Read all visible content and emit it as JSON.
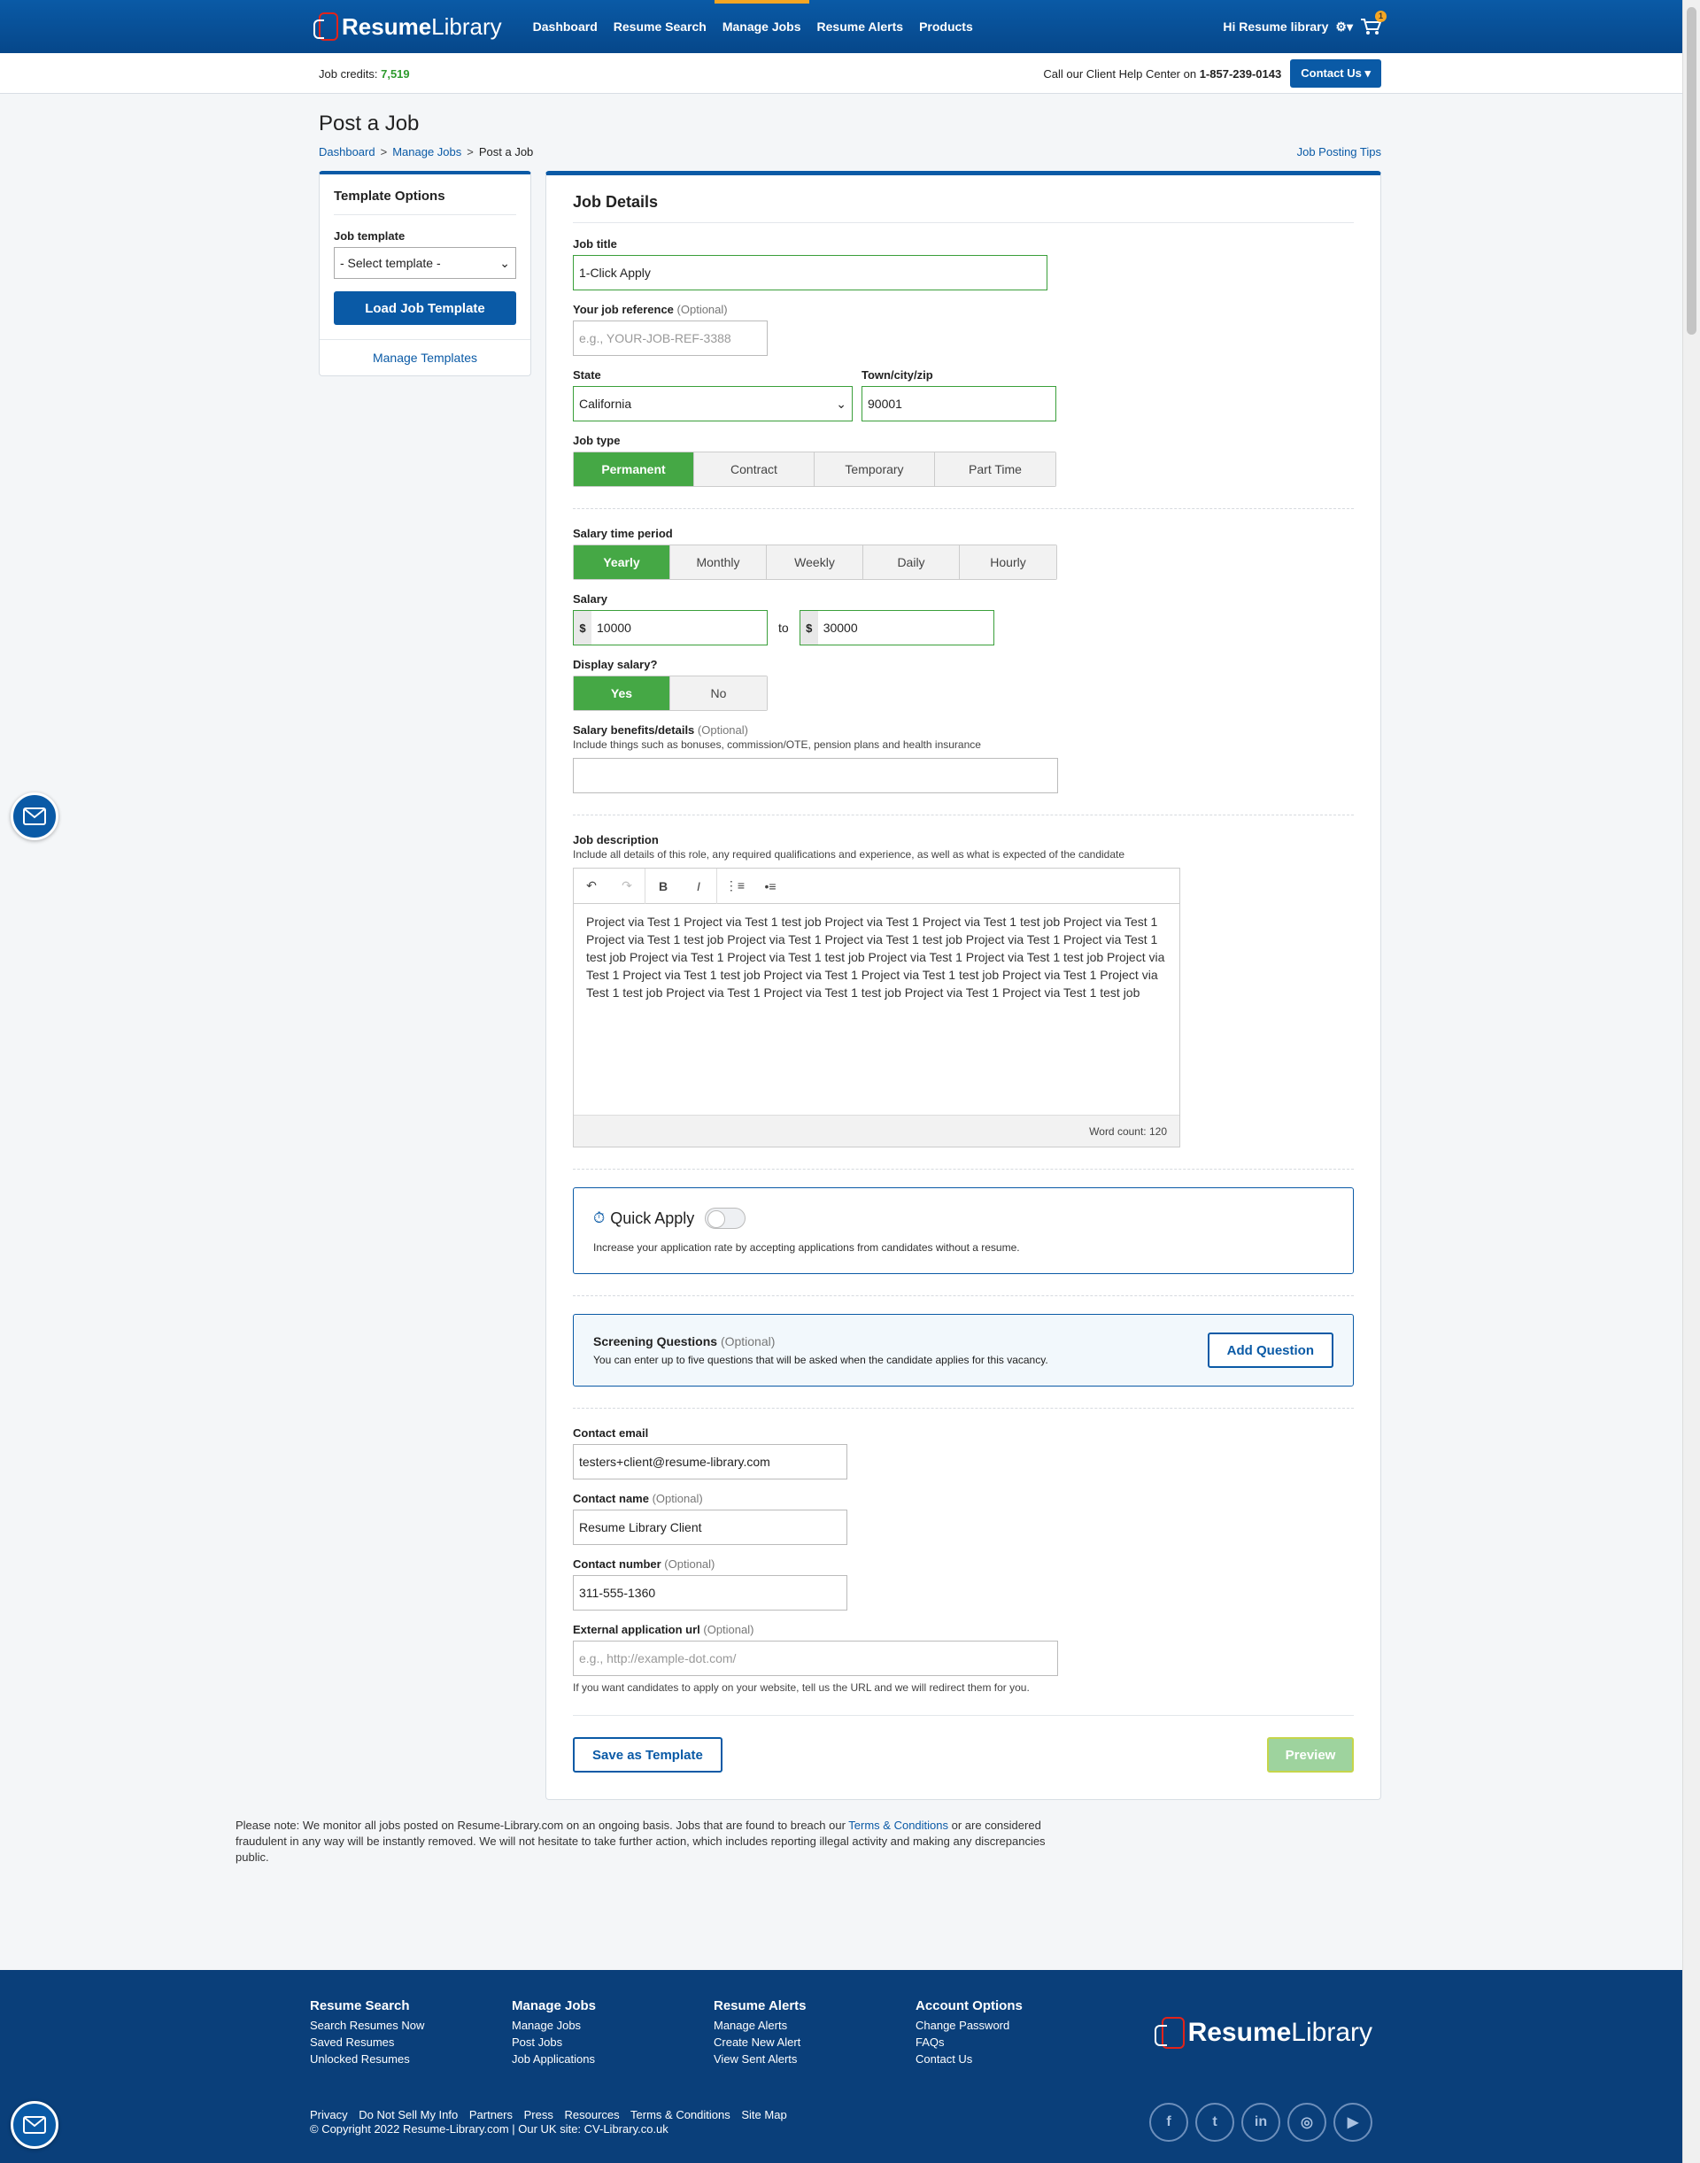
{
  "brand": {
    "logo_a": "Resume",
    "logo_b": "Library"
  },
  "nav": {
    "items": [
      "Dashboard",
      "Resume Search",
      "Manage Jobs",
      "Resume Alerts",
      "Products"
    ],
    "greeting": "Hi Resume library",
    "cart_count": "1"
  },
  "creditbar": {
    "label": "Job credits:",
    "value": "7,519",
    "help_text": "Call our Client Help Center on",
    "phone": "1-857-239-0143",
    "contact_label": "Contact Us"
  },
  "page": {
    "title": "Post a Job",
    "breadcrumbs": [
      "Dashboard",
      "Manage Jobs",
      "Post a Job"
    ],
    "tips_link": "Job Posting Tips"
  },
  "sidebar": {
    "title": "Template Options",
    "template_label": "Job template",
    "template_value": "- Select template -",
    "load_button": "Load Job Template",
    "manage_link": "Manage Templates"
  },
  "form": {
    "section_title": "Job Details",
    "job_title_label": "Job title",
    "job_title_value": "1-Click Apply",
    "reference_label": "Your job reference",
    "optional": "(Optional)",
    "reference_placeholder": "e.g., YOUR-JOB-REF-3388",
    "state_label": "State",
    "state_value": "California",
    "town_label": "Town/city/zip",
    "town_value": "90001",
    "job_type_label": "Job type",
    "job_types": [
      "Permanent",
      "Contract",
      "Temporary",
      "Part Time"
    ],
    "job_type_selected": "Permanent",
    "period_label": "Salary time period",
    "periods": [
      "Yearly",
      "Monthly",
      "Weekly",
      "Daily",
      "Hourly"
    ],
    "period_selected": "Yearly",
    "salary_label": "Salary",
    "currency": "$",
    "salary_from": "10000",
    "salary_to_word": "to",
    "salary_to": "30000",
    "display_label": "Display salary?",
    "display_options": [
      "Yes",
      "No"
    ],
    "display_selected": "Yes",
    "benefits_label": "Salary benefits/details",
    "benefits_hint": "Include things such as bonuses, commission/OTE, pension plans and health insurance",
    "desc_label": "Job description",
    "desc_hint": "Include all details of this role, any required qualifications and experience, as well as what is expected of the candidate",
    "desc_text": "Project via Test 1 Project via Test 1 test job Project via Test 1 Project via Test 1 test job Project via Test 1 Project via Test 1 test job Project via Test 1 Project via Test 1 test job Project via Test 1 Project via Test 1 test job Project via Test 1 Project via Test 1 test job Project via Test 1 Project via Test 1 test job Project via Test 1 Project via Test 1 test job Project via Test 1 Project via Test 1 test job Project via Test 1 Project via Test 1 test job Project via Test 1 Project via Test 1 test job Project via Test 1 Project via Test 1 test job",
    "word_count": "Word count: 120",
    "quick_apply_title": "Quick Apply",
    "quick_apply_text": "Increase your application rate by accepting applications from candidates without a resume.",
    "screening_title": "Screening Questions",
    "screening_text": "You can enter up to five questions that will be asked when the candidate applies for this vacancy.",
    "add_question": "Add Question",
    "email_label": "Contact email",
    "email_value": "testers+client@resume-library.com",
    "name_label": "Contact name",
    "name_value": "Resume Library Client",
    "number_label": "Contact number",
    "number_value": "311-555-1360",
    "url_label": "External application url",
    "url_placeholder": "e.g., http://example-dot.com/",
    "url_hint": "If you want candidates to apply on your website, tell us the URL and we will redirect them for you.",
    "save_template": "Save as Template",
    "preview": "Preview"
  },
  "note": {
    "text_a": "Please note: We monitor all jobs posted on Resume-Library.com on an ongoing basis. Jobs that are found to breach our ",
    "link": "Terms & Conditions",
    "text_b": " or are considered fraudulent in any way will be instantly removed. We will not hesitate to take further action, which includes reporting illegal activity and making any discrepancies public."
  },
  "footer": {
    "columns": [
      {
        "title": "Resume Search",
        "links": [
          "Search Resumes Now",
          "Saved Resumes",
          "Unlocked Resumes"
        ]
      },
      {
        "title": "Manage Jobs",
        "links": [
          "Manage Jobs",
          "Post Jobs",
          "Job Applications"
        ]
      },
      {
        "title": "Resume Alerts",
        "links": [
          "Manage Alerts",
          "Create New Alert",
          "View Sent Alerts"
        ]
      },
      {
        "title": "Account Options",
        "links": [
          "Change Password",
          "FAQs",
          "Contact Us"
        ]
      }
    ],
    "bottom_links": [
      "Privacy",
      "Do Not Sell My Info",
      "Partners",
      "Press",
      "Resources",
      "Terms & Conditions",
      "Site Map"
    ],
    "copyright": "© Copyright 2022 Resume-Library.com | Our UK site: CV-Library.co.uk"
  },
  "colors": {
    "brand_blue": "#0a5aa6",
    "selected_green": "#45a845",
    "footer_navy": "#0a3f7a",
    "nav_accent": "#f5a623"
  }
}
